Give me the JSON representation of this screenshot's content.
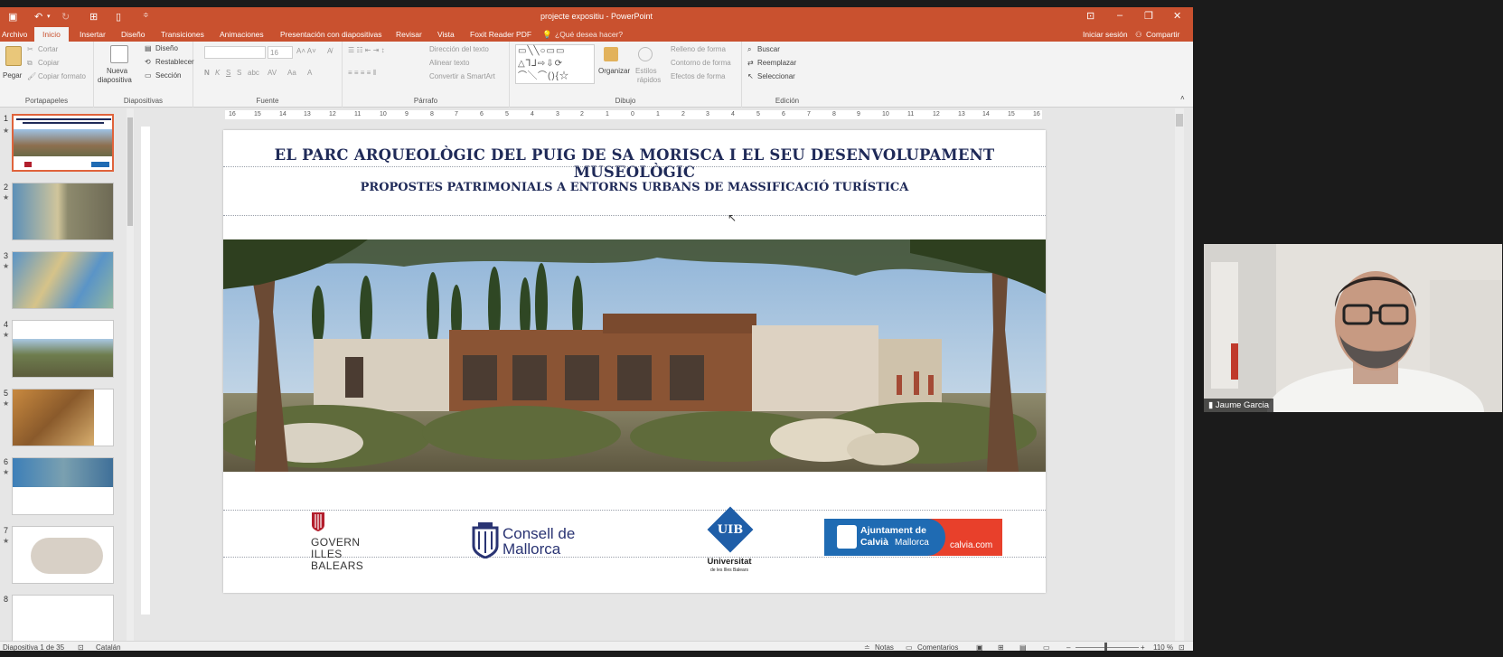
{
  "window": {
    "title": "projecte expositiu - PowerPoint",
    "sign_in": "Iniciar sesión",
    "share": "Compartir"
  },
  "tabs": [
    {
      "label": "Archivo"
    },
    {
      "label": "Inicio"
    },
    {
      "label": "Insertar"
    },
    {
      "label": "Diseño"
    },
    {
      "label": "Transiciones"
    },
    {
      "label": "Animaciones"
    },
    {
      "label": "Presentación con diapositivas"
    },
    {
      "label": "Revisar"
    },
    {
      "label": "Vista"
    },
    {
      "label": "Foxit Reader PDF"
    }
  ],
  "tell_me": "¿Qué desea hacer?",
  "ribbon": {
    "clipboard": {
      "paste": "Pegar",
      "cut": "Cortar",
      "copy": "Copiar",
      "format": "Copiar formato",
      "label": "Portapapeles"
    },
    "slides": {
      "new": "Nueva",
      "new2": "diapositiva",
      "layout": "Diseño",
      "reset": "Restablecer",
      "section": "Sección",
      "label": "Diapositivas"
    },
    "font": {
      "size": "16",
      "label": "Fuente"
    },
    "paragraph": {
      "direction": "Dirección del texto",
      "align": "Alinear texto",
      "smartart": "Convertir a SmartArt",
      "label": "Párrafo"
    },
    "drawing": {
      "arrange": "Organizar",
      "styles": "Estilos",
      "styles2": "rápidos",
      "fill": "Relleno de forma",
      "outline": "Contorno de forma",
      "effects": "Efectos de forma",
      "label": "Dibujo"
    },
    "editing": {
      "find": "Buscar",
      "replace": "Reemplazar",
      "select": "Seleccionar",
      "label": "Edición"
    }
  },
  "slide": {
    "title": "EL PARC ARQUEOLÒGIC DEL PUIG DE SA MORISCA I EL SEU DESENVOLUPAMENT MUSEOLÒGIC",
    "subtitle": "PROPOSTES PATRIMONIALS A ENTORNS URBANS DE MASSIFICACIÓ TURÍSTICA",
    "logos": {
      "govern": [
        "GOVERN",
        "ILLES",
        "BALEARS"
      ],
      "consell": [
        "Consell de",
        "Mallorca"
      ],
      "uib_mark": "UIB",
      "uib": [
        "Universitat",
        "de les Illes Balears"
      ],
      "calvia": [
        "Ajuntament de",
        "Calvià",
        "Mallorca",
        "calvia.com"
      ]
    }
  },
  "thumbnails": [
    "1",
    "2",
    "3",
    "4",
    "5",
    "6",
    "7",
    "8"
  ],
  "ruler_h": [
    "16",
    "15",
    "14",
    "13",
    "12",
    "11",
    "10",
    "9",
    "8",
    "7",
    "6",
    "5",
    "4",
    "3",
    "2",
    "1",
    "0",
    "1",
    "2",
    "3",
    "4",
    "5",
    "6",
    "7",
    "8",
    "9",
    "10",
    "11",
    "12",
    "13",
    "14",
    "15",
    "16"
  ],
  "status": {
    "slide": "Diapositiva 1 de 35",
    "lang": "Catalán",
    "notes": "Notas",
    "comments": "Comentarios",
    "zoom": "110 %"
  },
  "webcam": {
    "name": "Jaume Garcia"
  },
  "colors": {
    "accent": "#c9512f",
    "title_navy": "#1f2a58",
    "calvia_blue": "#1f6bb3",
    "calvia_red": "#e8402b"
  }
}
